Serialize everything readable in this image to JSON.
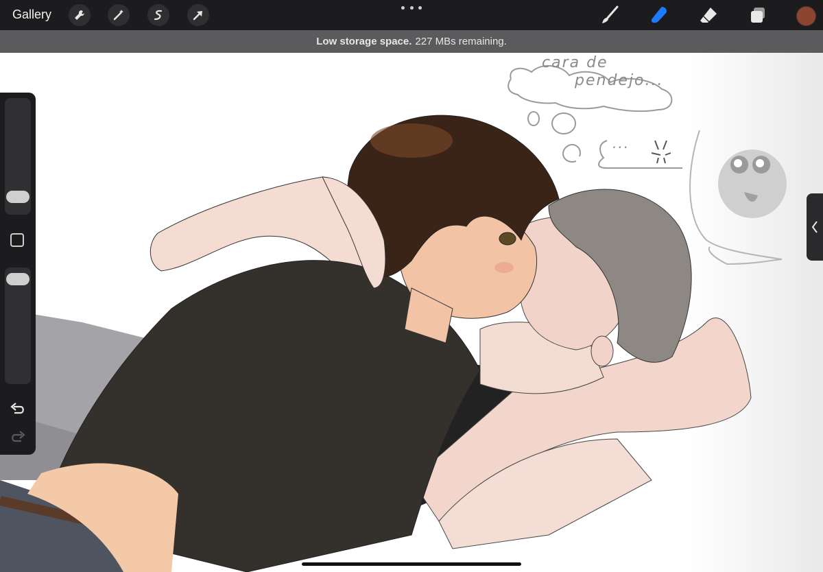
{
  "toolbar": {
    "gallery_label": "Gallery",
    "left_tools": [
      "wrench-icon",
      "magic-wand-icon",
      "selection-icon",
      "transform-arrow-icon"
    ],
    "right_tools": [
      "brush-icon",
      "smudge-icon",
      "eraser-icon",
      "layers-icon"
    ],
    "active_tool": "smudge-icon",
    "active_color": "#8a4631",
    "accent_color": "#1e7bff"
  },
  "notice": {
    "bold_text": "Low storage space.",
    "text": "227 MBs remaining."
  },
  "canvas": {
    "handwriting_top_line1": "cara de",
    "handwriting_top_line2": "pendejo...",
    "handwriting_speech": "..."
  },
  "sidebar": {
    "brush_size_level": 0.1,
    "opacity_level": 0.95,
    "tools": [
      "modify-square-icon",
      "undo-icon",
      "redo-icon"
    ]
  }
}
